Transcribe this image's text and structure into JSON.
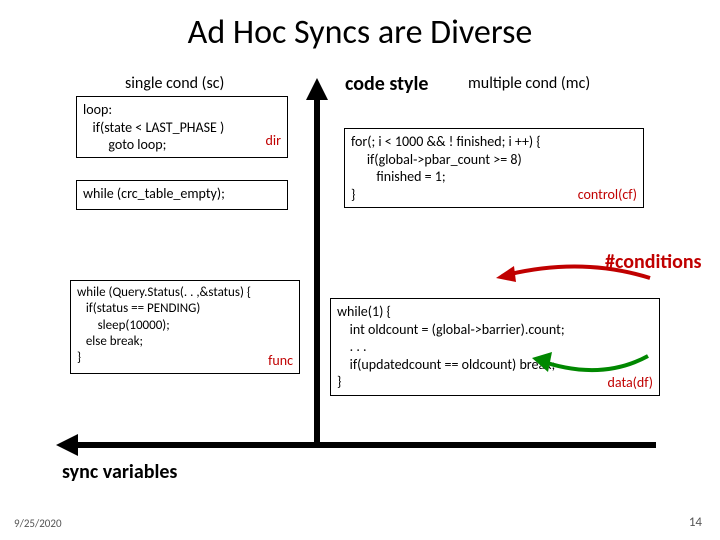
{
  "title": "Ad Hoc Syncs are Diverse",
  "headers": {
    "sc": "single cond (sc)",
    "mc": "multiple cond (mc)"
  },
  "axes": {
    "code_style": "code style",
    "sync_vars": "sync variables",
    "hash_conditions": "#conditions"
  },
  "tags": {
    "dir": "dir",
    "func": "func",
    "control": "control(cf)",
    "data": "data(df)"
  },
  "boxes": {
    "sc1": {
      "l1": "loop:",
      "l2": "   if(state < LAST_PHASE )",
      "l3": "        goto loop;"
    },
    "sc2": {
      "l1": "while (crc_table_empty);"
    },
    "sc3": {
      "l1": "while (Query.Status(. . ,&status) {",
      "l2": "   if(status == PENDING)",
      "l3": "       sleep(10000);",
      "l4": "   else break;",
      "l5": "}"
    },
    "mc1": {
      "l1": "for(; i < 1000 && ! finished; i ++) {",
      "l2": "     if(global->pbar_count >= 8)",
      "l3": "        finished = 1;",
      "l4": "}"
    },
    "mc2": {
      "l1": "while(1) {",
      "l2": "    int oldcount = (global->barrier).count;",
      "l3": "    . . .",
      "l4": "    if(updatedcount == oldcount) break;",
      "l5": "}"
    }
  },
  "footer": {
    "date": "9/25/2020",
    "page": "14"
  }
}
